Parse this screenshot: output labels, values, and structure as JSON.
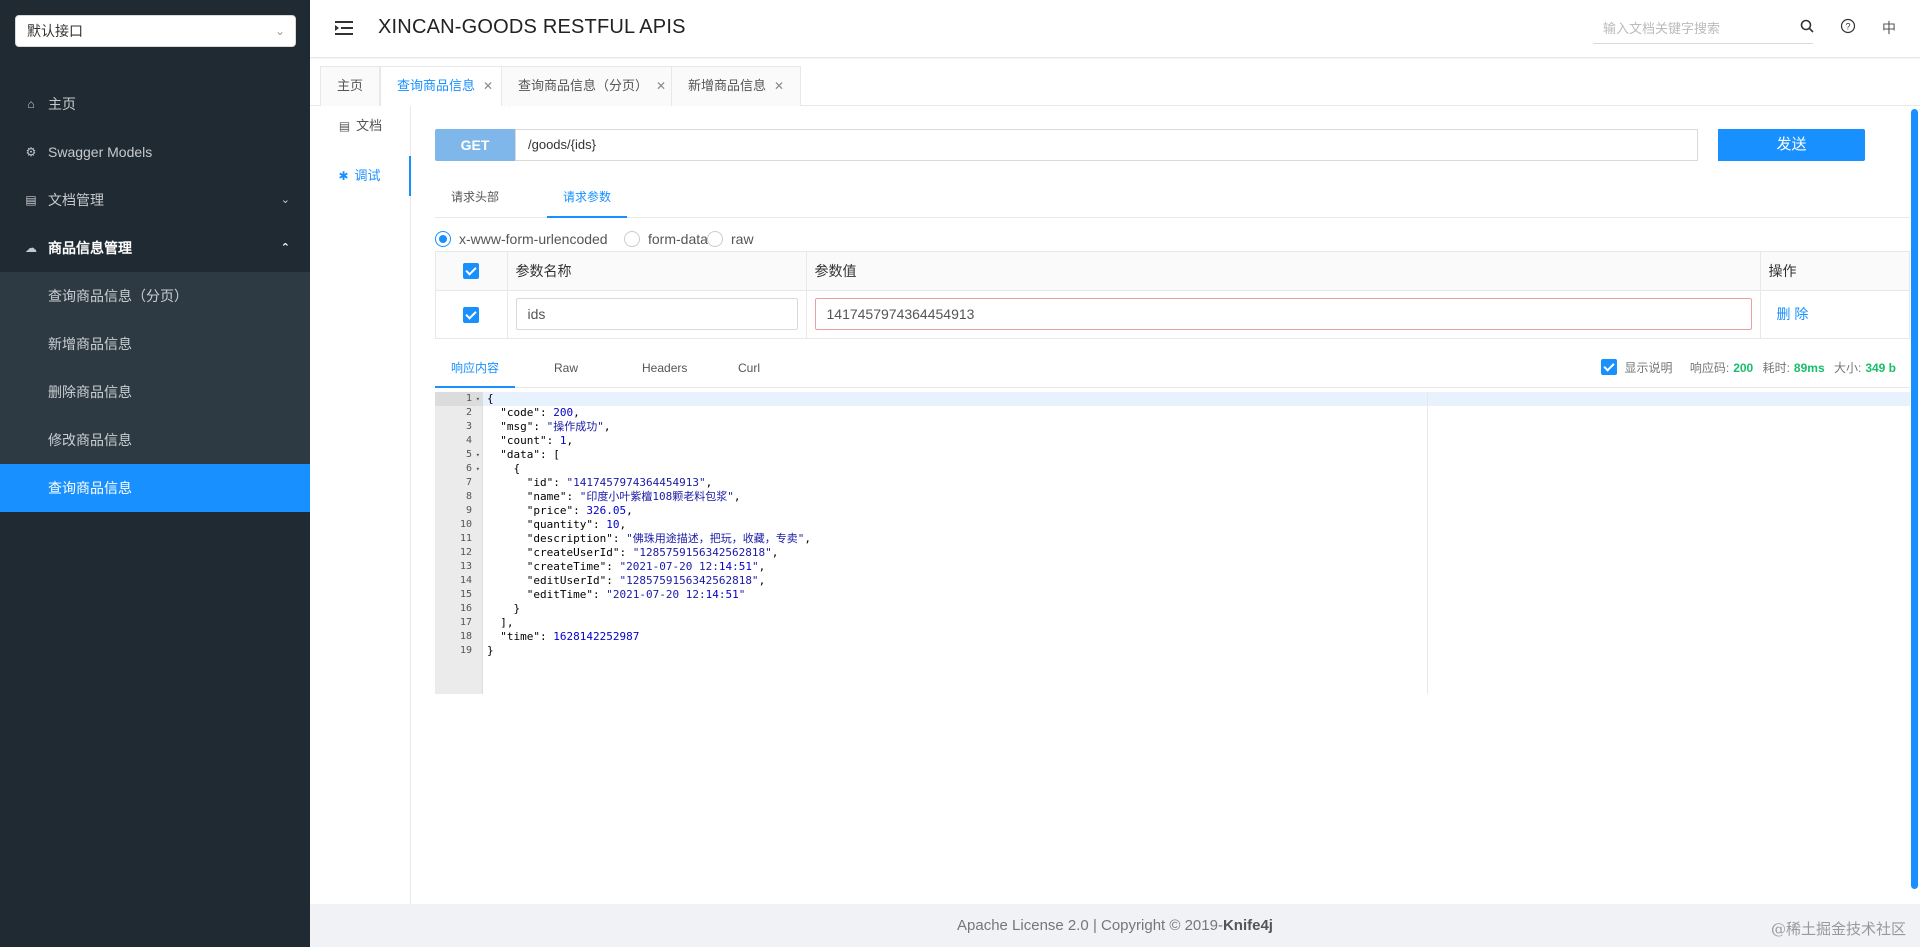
{
  "sidebar": {
    "group_select": "默认接口",
    "items": [
      {
        "label": "主页",
        "icon": "home-icon"
      },
      {
        "label": "Swagger Models",
        "icon": "gear-icon"
      },
      {
        "label": "文档管理",
        "icon": "doc-icon"
      },
      {
        "label": "商品信息管理",
        "icon": "cloud-icon"
      }
    ],
    "subitems": [
      {
        "label": "查询商品信息（分页）"
      },
      {
        "label": "新增商品信息"
      },
      {
        "label": "删除商品信息"
      },
      {
        "label": "修改商品信息"
      },
      {
        "label": "查询商品信息"
      }
    ]
  },
  "header": {
    "title": "XINCAN-GOODS RESTFUL APIS",
    "search_placeholder": "输入文档关键字搜索",
    "lang": "中"
  },
  "tabs": [
    {
      "label": "主页"
    },
    {
      "label": "查询商品信息"
    },
    {
      "label": "查询商品信息（分页）"
    },
    {
      "label": "新增商品信息"
    }
  ],
  "vtabs": [
    {
      "label": "文档"
    },
    {
      "label": "调试"
    }
  ],
  "request": {
    "method": "GET",
    "url": "/goods/{ids}",
    "send_label": "发送",
    "tabs": [
      {
        "label": "请求头部"
      },
      {
        "label": "请求参数"
      }
    ],
    "content_types": [
      {
        "label": "x-www-form-urlencoded",
        "selected": true
      },
      {
        "label": "form-data",
        "selected": false
      },
      {
        "label": "raw",
        "selected": false
      }
    ],
    "params_header": {
      "name": "参数名称",
      "value": "参数值",
      "action": "操作"
    },
    "params": [
      {
        "name": "ids",
        "value": "1417457974364454913",
        "action": "删 除"
      }
    ]
  },
  "response": {
    "tabs": [
      {
        "label": "响应内容"
      },
      {
        "label": "Raw"
      },
      {
        "label": "Headers"
      },
      {
        "label": "Curl"
      }
    ],
    "show_desc": "显示说明",
    "code_label": "响应码:",
    "code": "200",
    "time_label": "耗时:",
    "time": "89ms",
    "size_label": "大小:",
    "size": "349 b",
    "lines": [
      "{",
      "  \"code\": 200,",
      "  \"msg\": \"操作成功\",",
      "  \"count\": 1,",
      "  \"data\": [",
      "    {",
      "      \"id\": \"1417457974364454913\",",
      "      \"name\": \"印度小叶紫檀108颗老料包浆\",",
      "      \"price\": 326.05,",
      "      \"quantity\": 10,",
      "      \"description\": \"佛珠用途描述，把玩，收藏，专卖\",",
      "      \"createUserId\": \"1285759156342562818\",",
      "      \"createTime\": \"2021-07-20 12:14:51\",",
      "      \"editUserId\": \"1285759156342562818\",",
      "      \"editTime\": \"2021-07-20 12:14:51\"",
      "    }",
      "  ],",
      "  \"time\": 1628142252987",
      "}"
    ]
  },
  "footer": {
    "text": "Apache License 2.0 | Copyright © 2019-",
    "brand": "Knife4j"
  },
  "watermark": "@稀土掘金技术社区",
  "colors": {
    "accent": "#1890ff",
    "sidebar": "#1f2a33",
    "success": "#19be6b"
  }
}
